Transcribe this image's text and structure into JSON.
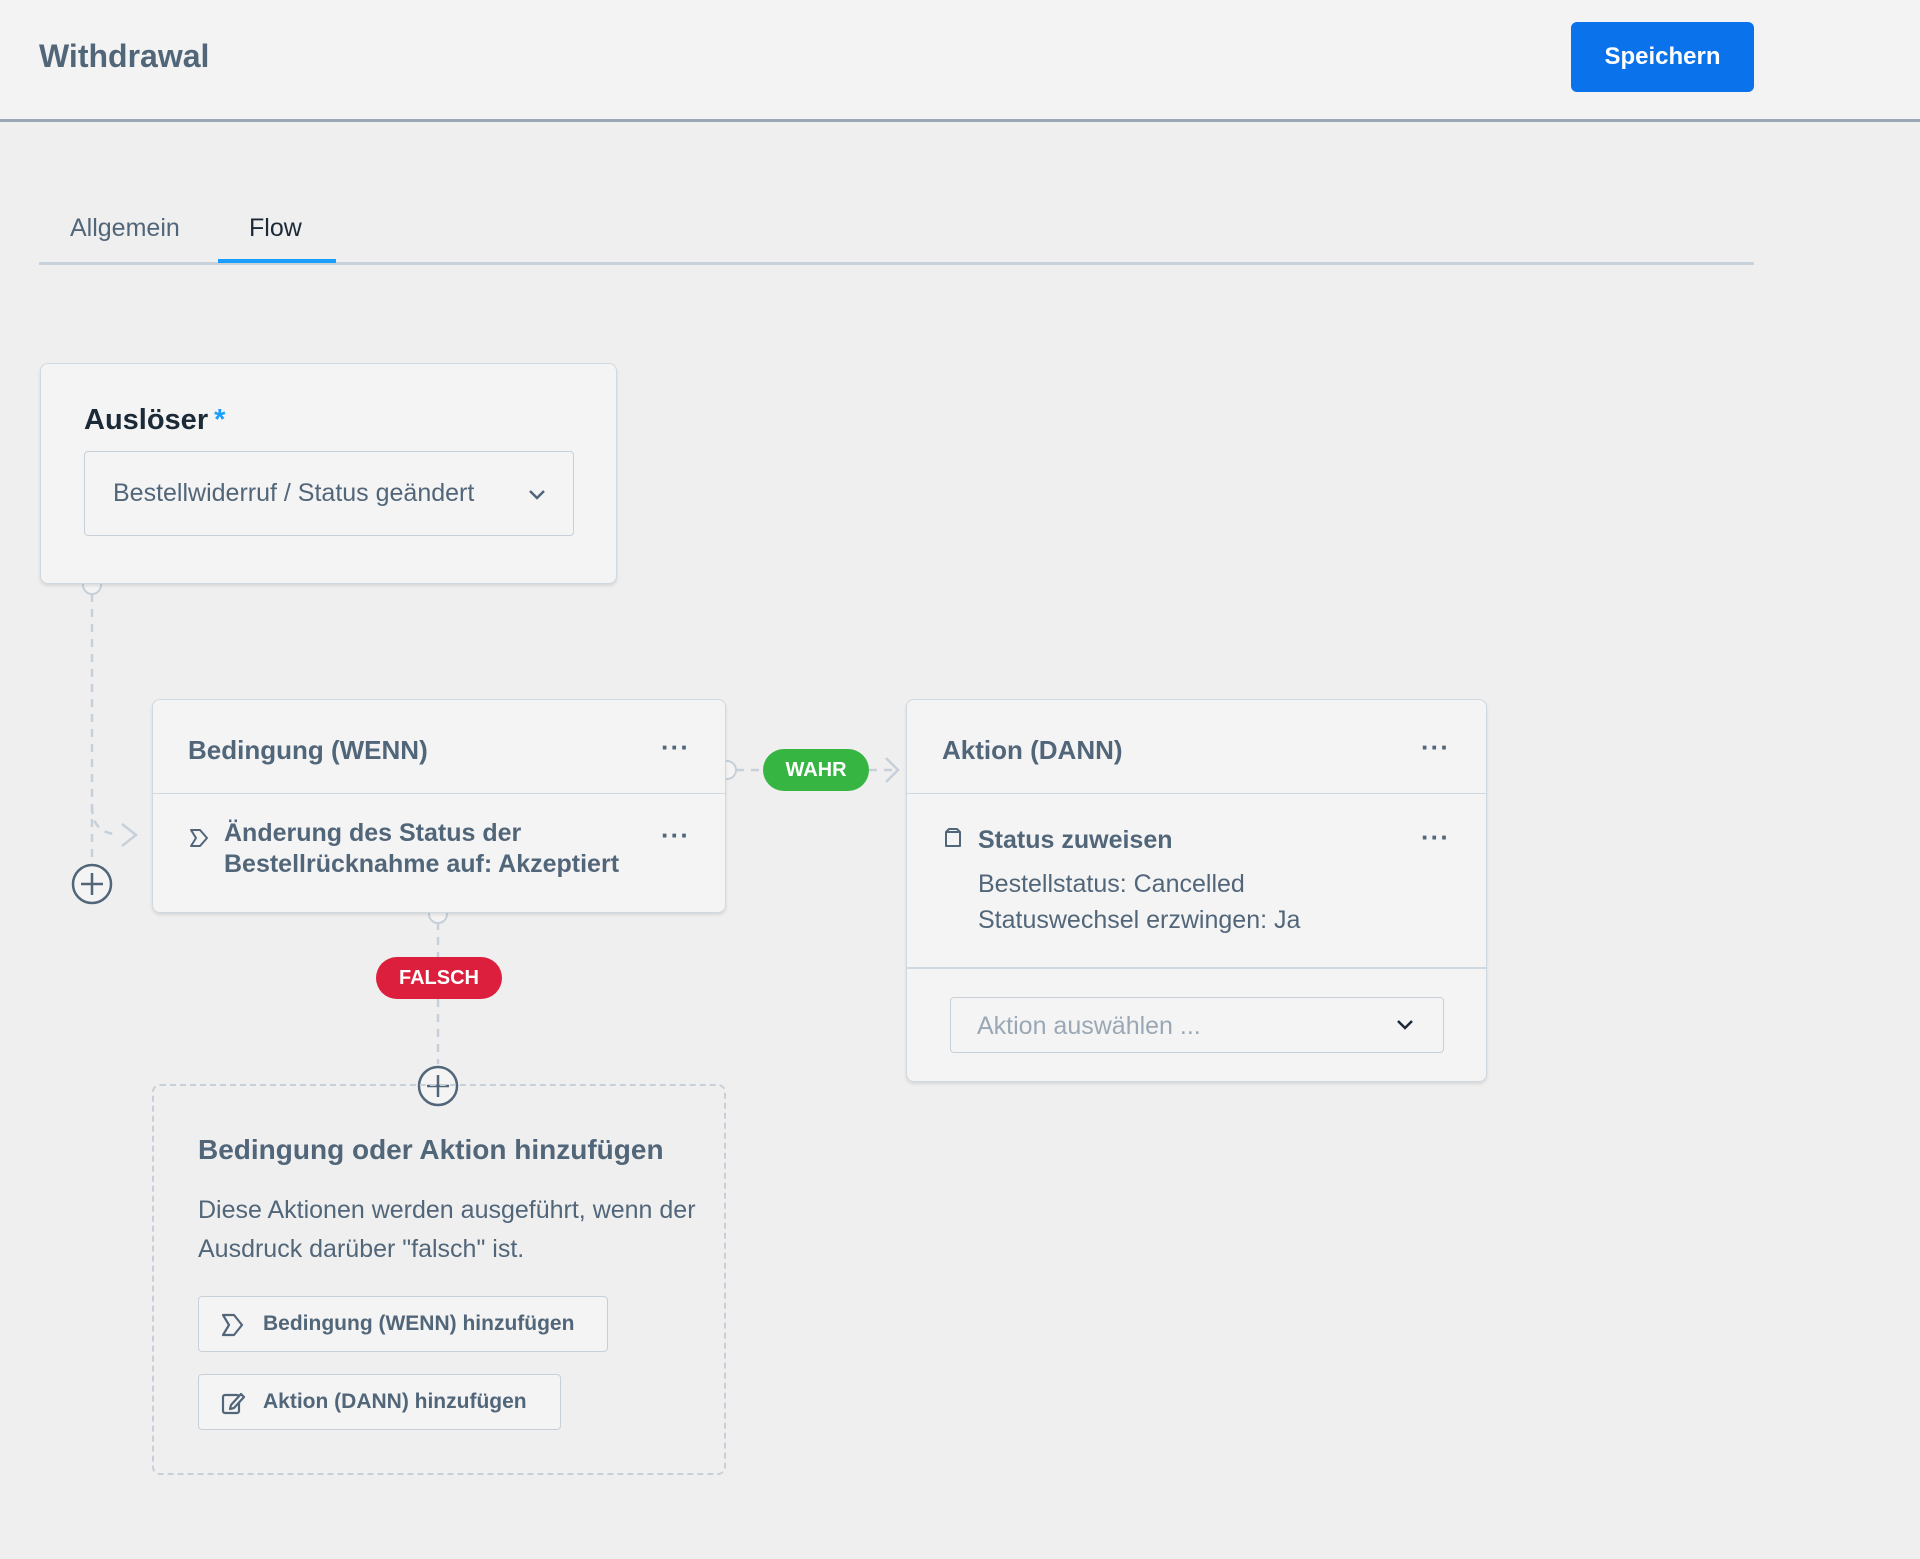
{
  "header": {
    "title": "Withdrawal",
    "save_label": "Speichern"
  },
  "tabs": [
    {
      "label": "Allgemein",
      "active": false
    },
    {
      "label": "Flow",
      "active": true
    }
  ],
  "trigger": {
    "label": "Auslöser",
    "required_mark": "*",
    "selected": "Bestellwiderruf / Status geändert"
  },
  "condition": {
    "title": "Bedingung (WENN)",
    "menu": "···",
    "rule_text": "Änderung des Status der Bestellrücknahme auf: Akzeptiert",
    "rule_menu": "···"
  },
  "branches": {
    "true_label": "WAHR",
    "false_label": "FALSCH"
  },
  "action": {
    "title": "Aktion (DANN)",
    "menu": "···",
    "item_title": "Status zuweisen",
    "item_menu": "···",
    "item_lines": [
      "Bestellstatus: Cancelled",
      "Statuswechsel erzwingen: Ja"
    ],
    "select_placeholder": "Aktion auswählen ..."
  },
  "false_branch": {
    "title": "Bedingung oder Aktion hinzufügen",
    "description": "Diese Aktionen werden ausgeführt, wenn der Ausdruck darüber \"falsch\" ist.",
    "add_condition_label": "Bedingung (WENN) hinzufügen",
    "add_action_label": "Aktion (DANN) hinzufügen"
  },
  "colors": {
    "primary": "#0a73eb",
    "true_pill": "#37b543",
    "false_pill": "#dc1f3c",
    "tab_active": "#189eff"
  },
  "icons": [
    "chevron-down-icon",
    "condition-icon",
    "status-icon",
    "plus-icon",
    "edit-icon",
    "more-icon"
  ]
}
